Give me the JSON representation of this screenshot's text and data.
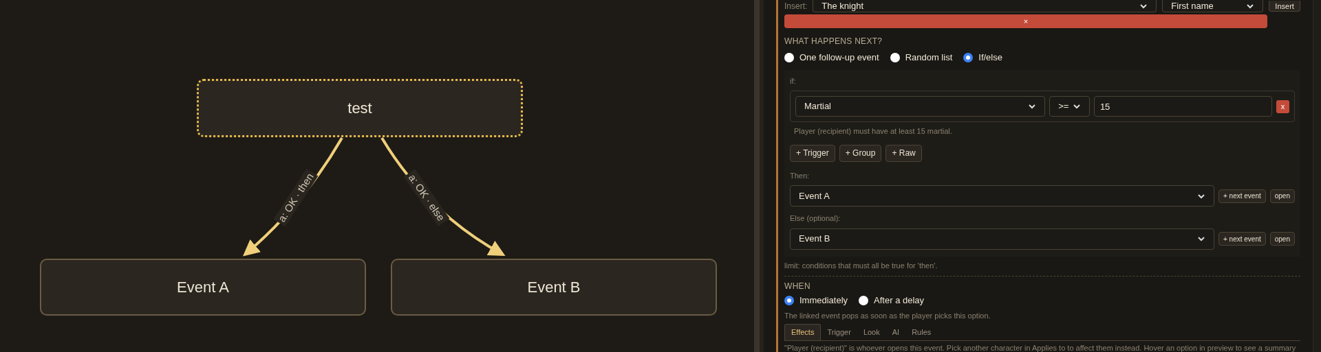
{
  "canvas": {
    "nodes": [
      {
        "label": "test",
        "selected": true
      },
      {
        "label": "Event A",
        "selected": false
      },
      {
        "label": "Event B",
        "selected": false
      }
    ],
    "edges": [
      {
        "label": "a: OK · then"
      },
      {
        "label": "a: OK · else"
      }
    ]
  },
  "panel": {
    "insert_row": {
      "label": "Insert:",
      "character": "The knight",
      "field": "First name",
      "button": "Insert"
    },
    "remove_bar": {
      "label": "×"
    },
    "next": {
      "heading": "WHAT HAPPENS NEXT?",
      "options": [
        {
          "label": "One follow-up event",
          "selected": false
        },
        {
          "label": "Random list",
          "selected": false
        },
        {
          "label": "If/else",
          "selected": true
        }
      ]
    },
    "ifelse": {
      "if_label": "if:",
      "condition": {
        "field": "Martial",
        "operator": ">=",
        "value": "15",
        "remove": "x"
      },
      "hint": "Player (recipient) must have at least 15 martial.",
      "add_buttons": [
        "+ Trigger",
        "+ Group",
        "+ Raw"
      ],
      "branches": [
        {
          "label": "Then:",
          "event": "Event A",
          "add": "+ next event",
          "open": "open"
        },
        {
          "label": "Else (optional):",
          "event": "Event B",
          "add": "+ next event",
          "open": "open"
        }
      ]
    },
    "limit_note": "limit: conditions that must all be true for 'then'.",
    "when": {
      "heading": "WHEN",
      "options": [
        {
          "label": "Immediately",
          "selected": true
        },
        {
          "label": "After a delay",
          "selected": false
        }
      ],
      "note": "The linked event pops as soon as the player picks this option."
    },
    "tabs": [
      {
        "label": "Effects",
        "selected": true
      },
      {
        "label": "Trigger",
        "selected": false
      },
      {
        "label": "Look",
        "selected": false
      },
      {
        "label": "AI",
        "selected": false
      },
      {
        "label": "Rules",
        "selected": false
      }
    ],
    "footer_note": "\"Player (recipient)\" is whoever opens this event. Pick another character in Applies to to affect them instead. Hover an option in preview to see a summary"
  }
}
